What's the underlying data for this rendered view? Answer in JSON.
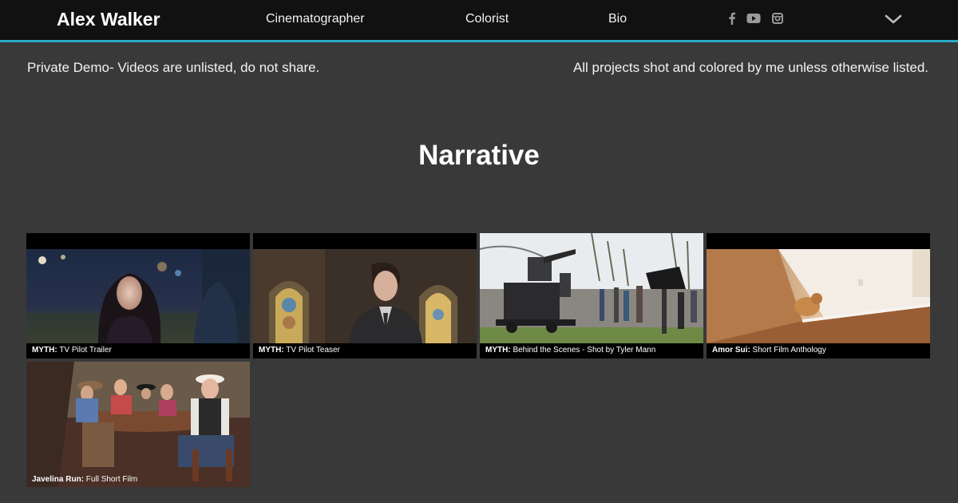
{
  "header": {
    "logo": "Alex Walker",
    "nav": [
      {
        "label": "Cinematographer"
      },
      {
        "label": "Colorist"
      },
      {
        "label": "Bio"
      }
    ],
    "social_icons": [
      "facebook-icon",
      "youtube-icon",
      "instagram-icon"
    ],
    "menu_icon": "chevron-down-icon",
    "accent_color": "#2aa9c8"
  },
  "notice": {
    "left": "Private Demo- Videos are unlisted, do not share.",
    "right": "All projects shot and colored by me unless otherwise listed."
  },
  "section": {
    "title": "Narrative"
  },
  "videos": [
    {
      "project": "MYTH:",
      "desc": " TV Pilot Trailer"
    },
    {
      "project": "MYTH:",
      "desc": " TV Pilot Teaser"
    },
    {
      "project": "MYTH:",
      "desc": " Behind the Scenes - Shot by Tyler Mann"
    },
    {
      "project": "Amor Sui:",
      "desc": " Short Film Anthology"
    },
    {
      "project": "Javelina Run:",
      "desc": " Full Short Film"
    }
  ]
}
